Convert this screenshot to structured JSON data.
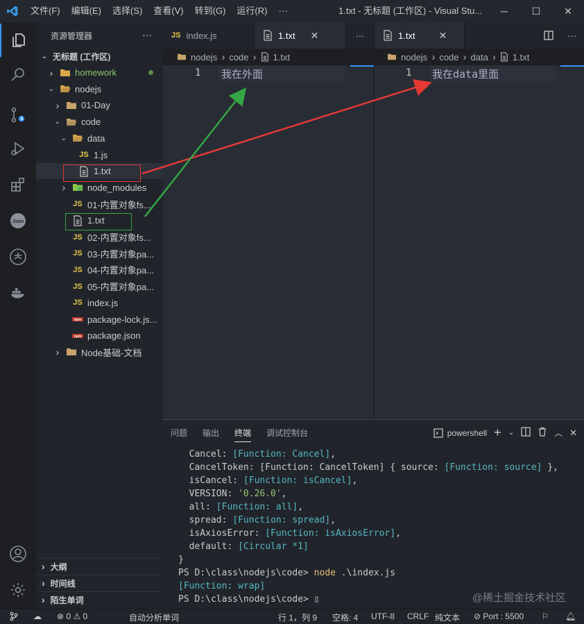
{
  "titlebar": {
    "menus": [
      "文件(F)",
      "编辑(E)",
      "选择(S)",
      "查看(V)",
      "转到(G)",
      "运行(R)",
      "···"
    ],
    "title": "1.txt - 无标题 (工作区) - Visual Stu..."
  },
  "sidebar": {
    "header": "资源管理器",
    "workspace": "无标题 (工作区)",
    "tree": [
      {
        "label": "homework",
        "kind": "folder-special",
        "expanded": false,
        "depth": 0,
        "modified": true
      },
      {
        "label": "nodejs",
        "kind": "folder-special",
        "expanded": true,
        "depth": 0
      },
      {
        "label": "01-Day",
        "kind": "folder",
        "expanded": false,
        "depth": 1
      },
      {
        "label": "code",
        "kind": "folder-open",
        "expanded": true,
        "depth": 1
      },
      {
        "label": "data",
        "kind": "folder-special",
        "expanded": true,
        "depth": 2
      },
      {
        "label": "1.js",
        "kind": "js",
        "depth": 3
      },
      {
        "label": "1.txt",
        "kind": "txt",
        "depth": 3,
        "selected": true
      },
      {
        "label": "node_modules",
        "kind": "node-folder",
        "expanded": false,
        "depth": 2
      },
      {
        "label": "01-内置对象fs...",
        "kind": "js",
        "depth": 2
      },
      {
        "label": "1.txt",
        "kind": "txt",
        "depth": 2
      },
      {
        "label": "02-内置对象fs...",
        "kind": "js",
        "depth": 2
      },
      {
        "label": "03-内置对象pa...",
        "kind": "js",
        "depth": 2
      },
      {
        "label": "04-内置对象pa...",
        "kind": "js",
        "depth": 2
      },
      {
        "label": "05-内置对象pa...",
        "kind": "js",
        "depth": 2
      },
      {
        "label": "index.js",
        "kind": "js",
        "depth": 2
      },
      {
        "label": "package-lock.js...",
        "kind": "npm",
        "depth": 2
      },
      {
        "label": "package.json",
        "kind": "npm",
        "depth": 2
      },
      {
        "label": "Node基础-文档",
        "kind": "folder",
        "expanded": false,
        "depth": 1
      }
    ],
    "sections": [
      "大纲",
      "时间线",
      "陌生单词"
    ]
  },
  "editor_left": {
    "tabs": [
      {
        "label": "index.js",
        "icon": "JS"
      },
      {
        "label": "1.txt",
        "icon": "txt"
      }
    ],
    "breadcrumb": [
      "nodejs",
      "code",
      "1.txt"
    ],
    "line_number": "1",
    "code": "我在外面"
  },
  "editor_right": {
    "tab": "1.txt",
    "breadcrumb": [
      "nodejs",
      "code",
      "data",
      "1.txt"
    ],
    "line_number": "1",
    "code": "我在data里面"
  },
  "panel": {
    "tabs": [
      "问题",
      "输出",
      "终端",
      "调试控制台"
    ],
    "active_tab": "终端",
    "shell": "powershell",
    "lines": [
      [
        {
          "t": "  Cancel: "
        },
        {
          "t": "[Function: Cancel]",
          "c": "cyan"
        },
        {
          "t": ","
        }
      ],
      [
        {
          "t": "  CancelToken: [Function: CancelToken] { source: "
        },
        {
          "t": "[Function: source]",
          "c": "cyan"
        },
        {
          "t": " },"
        }
      ],
      [
        {
          "t": "  isCancel: "
        },
        {
          "t": "[Function: isCancel]",
          "c": "cyan"
        },
        {
          "t": ","
        }
      ],
      [
        {
          "t": "  VERSION: "
        },
        {
          "t": "'0.26.0'",
          "c": "green"
        },
        {
          "t": ","
        }
      ],
      [
        {
          "t": "  all: "
        },
        {
          "t": "[Function: all]",
          "c": "cyan"
        },
        {
          "t": ","
        }
      ],
      [
        {
          "t": "  spread: "
        },
        {
          "t": "[Function: spread]",
          "c": "cyan"
        },
        {
          "t": ","
        }
      ],
      [
        {
          "t": "  isAxiosError: "
        },
        {
          "t": "[Function: isAxiosError]",
          "c": "cyan"
        },
        {
          "t": ","
        }
      ],
      [
        {
          "t": "  default: "
        },
        {
          "t": "[Circular *1]",
          "c": "cyan"
        }
      ],
      [
        {
          "t": "}"
        }
      ],
      [
        {
          "t": "PS D:\\class\\nodejs\\code> "
        },
        {
          "t": "node",
          "c": "yellow"
        },
        {
          "t": " .\\index.js"
        }
      ],
      [
        {
          "t": "[Function: wrap]",
          "c": "cyan"
        }
      ],
      [
        {
          "t": "PS D:\\class\\nodejs\\code> "
        },
        {
          "t": "▯"
        }
      ]
    ],
    "watermark": "@稀土掘金技术社区"
  },
  "statusbar": {
    "errors": "0",
    "warnings": "0",
    "auto_analyze": "自动分析单词",
    "position": "行 1，列 9",
    "spaces": "空格: 4",
    "encoding": "UTF-8",
    "eol": "CRLF",
    "language": "纯文本",
    "port": "Port : 5500"
  },
  "colors": {
    "accent": "#3794ff",
    "red_annotation": "#e53935",
    "green_annotation": "#35a645"
  }
}
